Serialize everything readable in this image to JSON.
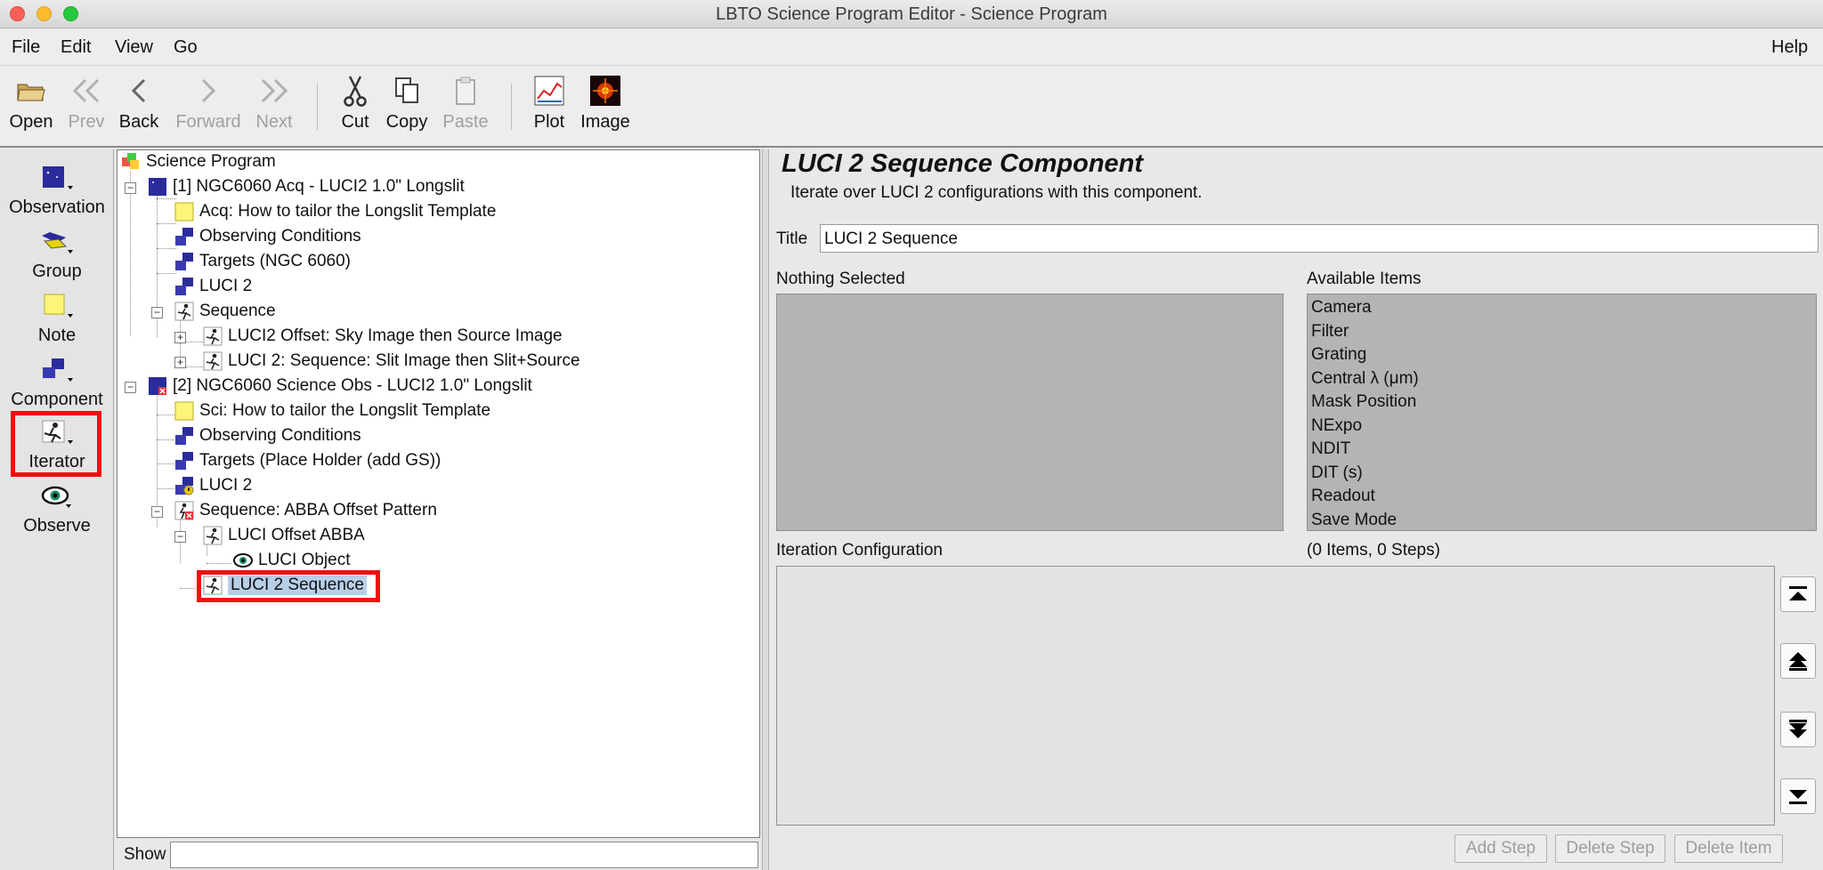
{
  "window": {
    "title": "LBTO Science Program Editor - Science Program"
  },
  "menubar": {
    "file": "File",
    "edit": "Edit",
    "view": "View",
    "go": "Go",
    "help": "Help"
  },
  "toolbar": {
    "open": "Open",
    "prev": "Prev",
    "back": "Back",
    "forward": "Forward",
    "next": "Next",
    "cut": "Cut",
    "copy": "Copy",
    "paste": "Paste",
    "plot": "Plot",
    "image": "Image"
  },
  "palette": {
    "observation": "Observation",
    "group": "Group",
    "note": "Note",
    "component": "Component",
    "iterator": "Iterator",
    "observe": "Observe"
  },
  "tree": {
    "root": "Science Program",
    "n1": "[1] NGC6060 Acq - LUCI2 1.0\" Longslit",
    "n1_note": "Acq: How to tailor the Longslit Template",
    "n1_cond": "Observing Conditions",
    "n1_targets": "Targets (NGC 6060)",
    "n1_luci": "LUCI 2",
    "n1_seq": "Sequence",
    "n1_offset": "LUCI2 Offset: Sky Image then Source Image",
    "n1_seq2": "LUCI 2: Sequence: Slit Image then Slit+Source",
    "n2": "[2] NGC6060 Science Obs  - LUCI2 1.0\" Longslit",
    "n2_note": "Sci: How to tailor the Longslit Template",
    "n2_cond": "Observing Conditions",
    "n2_targets": "Targets (Place Holder (add GS))",
    "n2_luci": "LUCI 2",
    "n2_seq": "Sequence: ABBA Offset Pattern",
    "n2_abba": "LUCI Offset ABBA",
    "n2_object": "LUCI Object",
    "n2_luci_seq": "LUCI 2 Sequence"
  },
  "show_label": "Show",
  "editor": {
    "heading": "LUCI 2 Sequence Component",
    "description": "Iterate over LUCI 2 configurations with this component.",
    "title_label": "Title",
    "title_value": "LUCI 2 Sequence",
    "nothing_selected": "Nothing Selected",
    "available_label": "Available Items",
    "available_items": [
      "Camera",
      "Filter",
      "Grating",
      "Central λ (μm)",
      "Mask Position",
      "NExpo",
      "NDIT",
      "DIT (s)",
      "Readout",
      "Save Mode"
    ],
    "iteration_label": "Iteration Configuration",
    "items_steps": "(0 Items, 0 Steps)",
    "add_step": "Add Step",
    "delete_step": "Delete Step",
    "delete_item": "Delete Item"
  }
}
